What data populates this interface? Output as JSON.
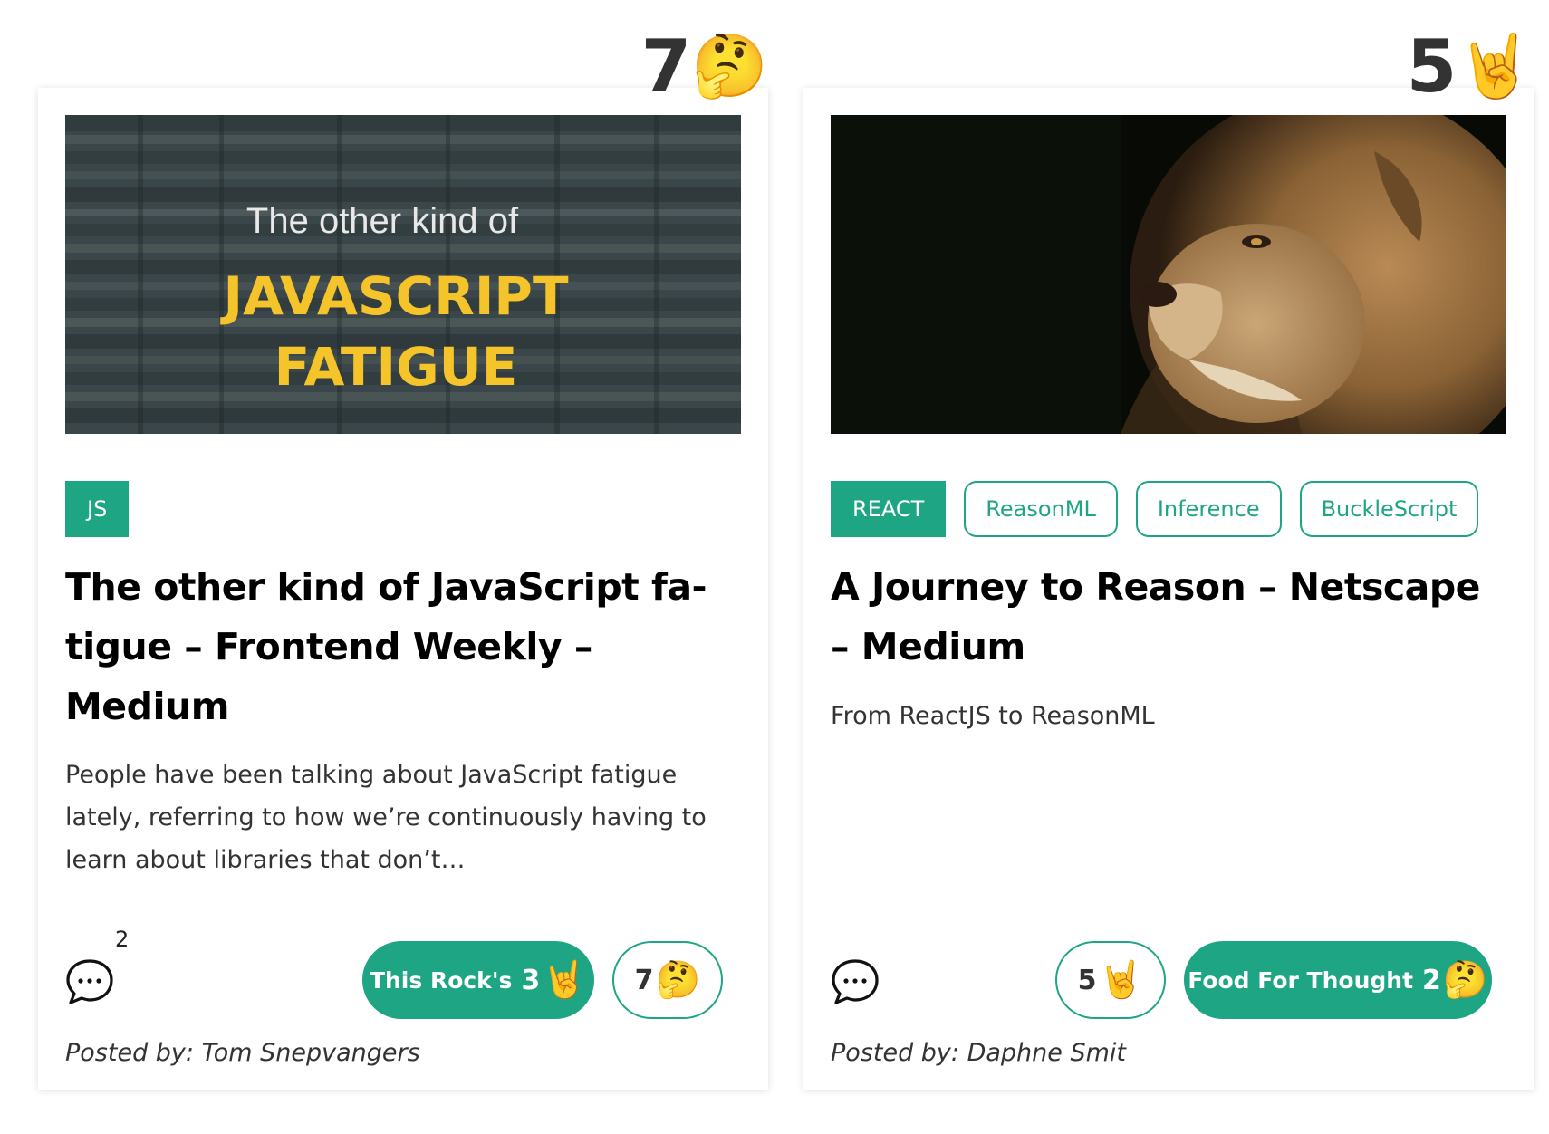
{
  "cards": [
    {
      "score": "7",
      "score_emoji": "🤔",
      "image": {
        "line1": "The other kind of",
        "line2": "JAVASCRIPT",
        "line3": "FATIGUE"
      },
      "tags": [
        "JS"
      ],
      "title": "The other kind of JavaScript fa-tigue – Frontend Weekly – Medium",
      "description": "People have been talking about JavaScript fatigue lately, referring to how we’re continuously having to learn about libraries that don’t…",
      "comment_count": "2",
      "reactions": [
        {
          "label": "This Rock's",
          "count": "3",
          "emoji": "🤘",
          "active": true
        },
        {
          "label": "",
          "count": "7",
          "emoji": "🤔",
          "active": false
        }
      ],
      "posted_by": "Posted by: Tom Snepvangers"
    },
    {
      "score": "5",
      "score_emoji": "🤘",
      "image": {
        "alt": "lion"
      },
      "tags": [
        "REACT",
        "ReasonML",
        "Inference",
        "BuckleScript"
      ],
      "title": "A Journey to Reason – Netscape – Medium",
      "description": "From ReactJS to ReasonML",
      "comment_count": "",
      "reactions": [
        {
          "label": "",
          "count": "5",
          "emoji": "🤘",
          "active": false
        },
        {
          "label": "Food For Thought",
          "count": "2",
          "emoji": "🤔",
          "active": true
        }
      ],
      "posted_by": "Posted by: Daphne Smit"
    }
  ],
  "colors": {
    "accent": "#1da584",
    "text": "#111111",
    "muted": "#333333",
    "image_title": "#f5c42a"
  },
  "icons": {
    "comment": "speech-bubble-icon"
  }
}
